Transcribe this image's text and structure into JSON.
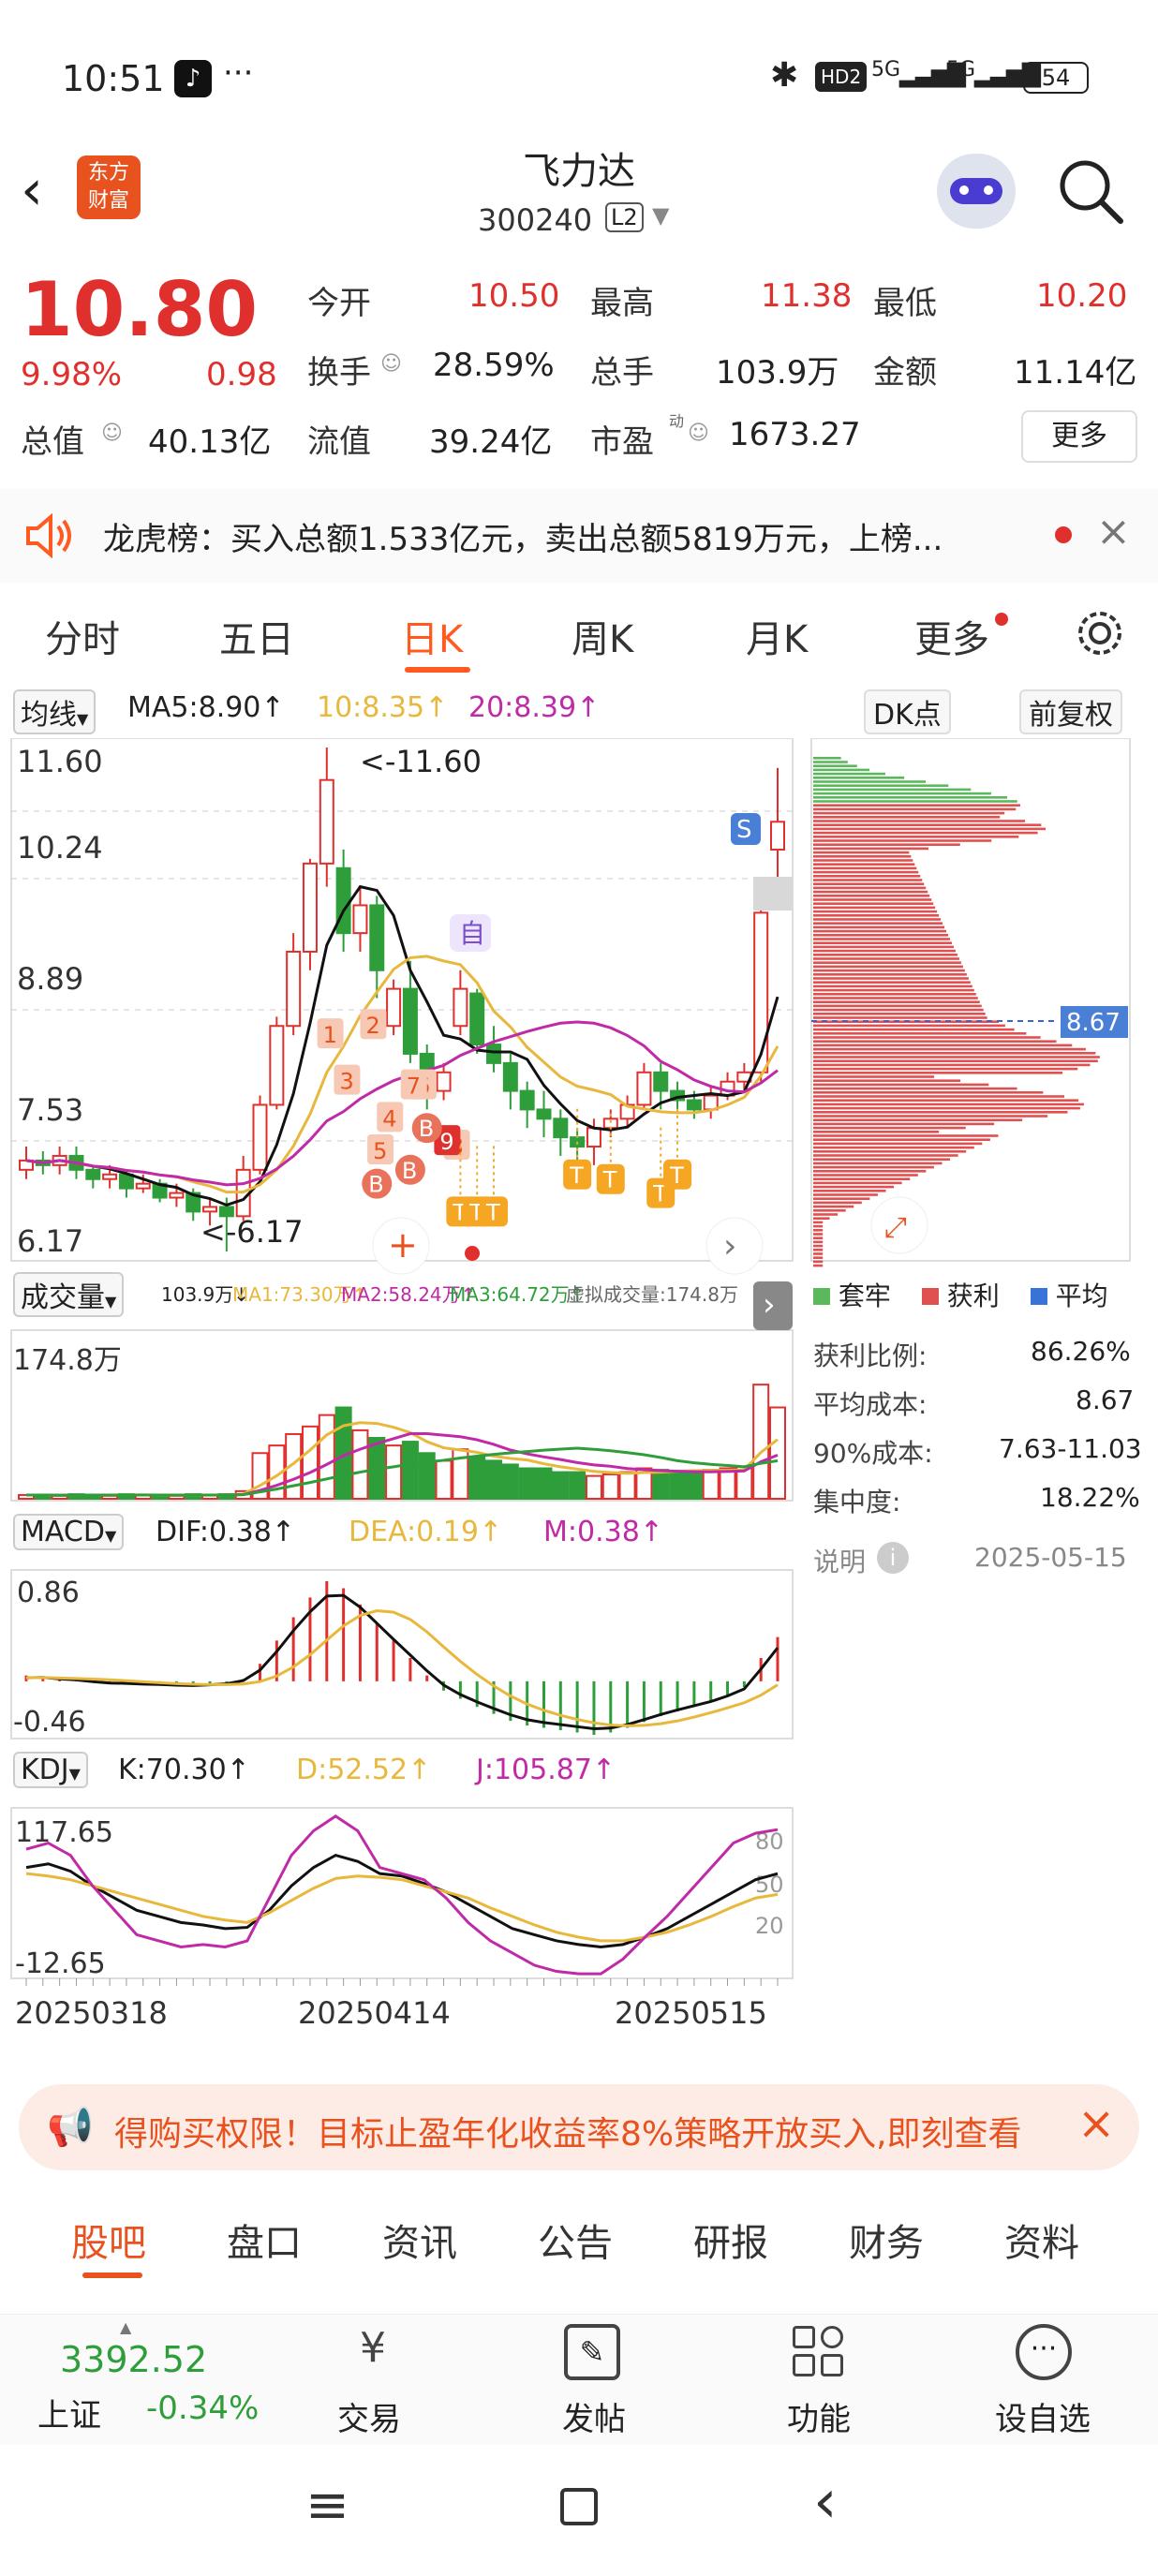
{
  "status_bar": {
    "time": "10:51",
    "battery": "54",
    "net1": "HD2",
    "net2": "5G",
    "net3": "5G"
  },
  "header": {
    "app_logo": "东方\n财富",
    "logo_l1": "东方",
    "logo_l2": "财富",
    "title": "飞力达",
    "code": "300240",
    "badge": "L2"
  },
  "quote": {
    "price": "10.80",
    "change_pct": "9.98%",
    "change": "0.98",
    "open_label": "今开",
    "open": "10.50",
    "high_label": "最高",
    "high": "11.38",
    "low_label": "最低",
    "low": "10.20",
    "turnover_label": "换手",
    "turnover": "28.59%",
    "volume_label": "总手",
    "volume": "103.9万",
    "amount_label": "金额",
    "amount": "11.14亿",
    "mktcap_label": "总值",
    "mktcap": "40.13亿",
    "float_label": "流值",
    "float": "39.24亿",
    "pe_label": "市盈",
    "pe_sup": "动",
    "pe": "1673.27",
    "more": "更多"
  },
  "banner": {
    "text": "龙虎榜：买入总额1.533亿元，卖出总额5819万元，上榜..."
  },
  "tabs": [
    "分时",
    "五日",
    "日K",
    "周K",
    "月K",
    "更多"
  ],
  "active_tab": "日K",
  "kline": {
    "indicator": "均线",
    "ma5": "MA5:8.90↑",
    "ma10": "10:8.35↑",
    "ma20": "20:8.39↑",
    "dk": "DK点",
    "adjust": "前复权",
    "y_labels": [
      "11.60",
      "10.24",
      "8.89",
      "7.53",
      "6.17"
    ],
    "max_note": "<-11.60",
    "min_note": "<-6.17",
    "self_mark": "自",
    "s_mark": "S",
    "b_mark": "B",
    "t_mark": "T",
    "num_marks": [
      "1",
      "2",
      "3",
      "4",
      "5",
      "6",
      "7",
      "8",
      "9"
    ],
    "cost_label": "8.67"
  },
  "chart_data": [
    {
      "type": "candlestick",
      "title": "日K",
      "x_ticks": [
        "20250318",
        "20250414",
        "20250515"
      ],
      "ylim": [
        6.17,
        11.6
      ],
      "candles": [
        [
          7.05,
          7.15,
          7.3,
          6.95
        ],
        [
          7.15,
          7.1,
          7.25,
          7.0
        ],
        [
          7.1,
          7.2,
          7.3,
          7.0
        ],
        [
          7.2,
          7.05,
          7.3,
          6.95
        ],
        [
          7.05,
          6.95,
          7.1,
          6.85
        ],
        [
          6.95,
          7.0,
          7.1,
          6.85
        ],
        [
          7.0,
          6.85,
          7.05,
          6.75
        ],
        [
          6.85,
          6.9,
          7.0,
          6.8
        ],
        [
          6.9,
          6.75,
          6.95,
          6.7
        ],
        [
          6.75,
          6.8,
          6.9,
          6.65
        ],
        [
          6.8,
          6.6,
          6.85,
          6.5
        ],
        [
          6.6,
          6.65,
          6.75,
          6.45
        ],
        [
          6.65,
          6.55,
          6.75,
          6.17
        ],
        [
          6.55,
          7.05,
          7.2,
          6.5
        ],
        [
          7.05,
          7.75,
          7.85,
          7.0
        ],
        [
          7.75,
          8.6,
          8.7,
          7.7
        ],
        [
          8.6,
          9.4,
          9.6,
          8.5
        ],
        [
          9.4,
          10.35,
          10.4,
          9.2
        ],
        [
          10.35,
          11.25,
          11.6,
          10.1
        ],
        [
          10.3,
          9.6,
          10.5,
          9.4
        ],
        [
          9.6,
          9.9,
          10.1,
          9.4
        ],
        [
          9.9,
          9.2,
          10.0,
          8.9
        ],
        [
          8.6,
          9.0,
          9.1,
          8.5
        ],
        [
          9.0,
          8.3,
          9.3,
          8.2
        ],
        [
          8.3,
          7.9,
          8.4,
          7.7
        ],
        [
          7.9,
          8.1,
          8.2,
          7.8
        ],
        [
          8.6,
          9.0,
          9.2,
          8.5
        ],
        [
          8.95,
          8.4,
          9.0,
          8.3
        ],
        [
          8.4,
          8.2,
          8.6,
          8.1
        ],
        [
          8.2,
          7.9,
          8.3,
          7.7
        ],
        [
          7.9,
          7.7,
          8.0,
          7.5
        ],
        [
          7.7,
          7.6,
          7.9,
          7.4
        ],
        [
          7.6,
          7.4,
          7.7,
          7.2
        ],
        [
          7.4,
          7.3,
          7.5,
          7.0
        ],
        [
          7.3,
          7.5,
          7.6,
          7.1
        ],
        [
          7.5,
          7.6,
          7.7,
          7.4
        ],
        [
          7.6,
          7.75,
          7.85,
          7.5
        ],
        [
          7.75,
          8.1,
          8.2,
          7.7
        ],
        [
          8.1,
          7.9,
          8.2,
          7.7
        ],
        [
          7.9,
          7.8,
          8.0,
          7.7
        ],
        [
          7.8,
          7.7,
          7.9,
          7.6
        ],
        [
          7.7,
          7.85,
          7.95,
          7.6
        ],
        [
          7.85,
          8.0,
          8.1,
          7.8
        ],
        [
          8.0,
          8.1,
          8.2,
          7.9
        ],
        [
          8.1,
          9.82,
          9.9,
          8.0
        ],
        [
          10.5,
          10.8,
          11.38,
          10.2
        ]
      ],
      "series": [
        {
          "name": "MA5",
          "current": 8.9
        },
        {
          "name": "MA10",
          "current": 8.35
        },
        {
          "name": "MA20",
          "current": 8.39
        }
      ]
    },
    {
      "type": "bar",
      "title": "成交量",
      "max_label": "174.8万",
      "labels": {
        "vol": "103.9万↓",
        "ma1": "MA1:73.30万↑",
        "ma2": "MA2:58.24万↑",
        "ma3": "MA3:64.72万↑",
        "virtual": "虚拟成交量:174.8万"
      },
      "values": [
        5,
        5,
        4,
        6,
        5,
        4,
        6,
        5,
        4,
        4,
        6,
        5,
        6,
        10,
        60,
        70,
        85,
        95,
        110,
        120,
        90,
        80,
        70,
        75,
        60,
        50,
        65,
        55,
        50,
        45,
        40,
        40,
        35,
        35,
        30,
        32,
        35,
        40,
        38,
        36,
        35,
        38,
        40,
        42,
        150,
        120
      ]
    },
    {
      "type": "bar",
      "title": "MACD",
      "labels": {
        "dif": "DIF:0.38↑",
        "dea": "DEA:0.19↑",
        "m": "M:0.38↑"
      },
      "y_labels": [
        "0.86",
        "-0.46"
      ],
      "values": [
        0.05,
        0.03,
        0.02,
        0.01,
        -0.01,
        -0.02,
        -0.02,
        -0.03,
        -0.03,
        -0.04,
        -0.04,
        -0.03,
        -0.02,
        0.02,
        0.15,
        0.35,
        0.55,
        0.72,
        0.86,
        0.8,
        0.66,
        0.5,
        0.35,
        0.2,
        0.05,
        -0.08,
        -0.15,
        -0.22,
        -0.28,
        -0.34,
        -0.38,
        -0.4,
        -0.42,
        -0.44,
        -0.46,
        -0.44,
        -0.4,
        -0.35,
        -0.3,
        -0.26,
        -0.22,
        -0.18,
        -0.12,
        -0.05,
        0.2,
        0.38
      ]
    },
    {
      "type": "line",
      "title": "KDJ",
      "labels": {
        "k": "K:70.30↑",
        "d": "D:52.52↑",
        "j": "J:105.87↑"
      },
      "y_labels": [
        "117.65",
        "-12.65"
      ],
      "right_ticks": [
        "80",
        "50",
        "20"
      ],
      "series": [
        {
          "name": "K",
          "values": [
            75,
            78,
            72,
            60,
            50,
            40,
            35,
            30,
            28,
            25,
            26,
            40,
            60,
            75,
            85,
            80,
            70,
            68,
            62,
            55,
            45,
            35,
            25,
            20,
            15,
            12,
            10,
            12,
            18,
            25,
            35,
            45,
            55,
            65,
            70
          ]
        },
        {
          "name": "D",
          "values": [
            70,
            68,
            65,
            60,
            55,
            50,
            45,
            40,
            35,
            32,
            30,
            38,
            48,
            58,
            66,
            68,
            67,
            65,
            60,
            55,
            50,
            42,
            35,
            28,
            22,
            18,
            15,
            15,
            18,
            22,
            28,
            35,
            43,
            50,
            53
          ]
        },
        {
          "name": "J",
          "values": [
            90,
            95,
            85,
            60,
            40,
            20,
            15,
            10,
            12,
            10,
            15,
            50,
            85,
            105,
            117,
            105,
            75,
            70,
            65,
            50,
            30,
            15,
            5,
            -5,
            -10,
            -12,
            -12,
            0,
            18,
            35,
            55,
            75,
            95,
            103,
            106
          ]
        }
      ]
    }
  ],
  "chips": {
    "legend": [
      "套牢",
      "获利",
      "平均"
    ],
    "profit_label": "获利比例:",
    "profit": "86.26%",
    "avgcost_label": "平均成本:",
    "avgcost": "8.67",
    "cost90_label": "90%成本:",
    "cost90": "7.63-11.03",
    "conc_label": "集中度:",
    "conc": "18.22%",
    "note": "说明",
    "date": "2025-05-15"
  },
  "ad": {
    "text": "得购买权限！目标止盈年化收益率8%策略开放买入,即刻查看"
  },
  "subtabs": [
    "股吧",
    "盘口",
    "资讯",
    "公告",
    "研报",
    "财务",
    "资料"
  ],
  "bottom": {
    "index_value": "3392.52",
    "index_name": "上证",
    "index_change": "-0.34%",
    "buttons": [
      "交易",
      "发帖",
      "功能",
      "设自选"
    ]
  },
  "colors": {
    "up": "#e0302d",
    "down": "#2e9e3a",
    "ma5": "#111111",
    "ma10": "#e8b83c",
    "ma20": "#c02aa6",
    "accent": "#ff5a1f"
  }
}
